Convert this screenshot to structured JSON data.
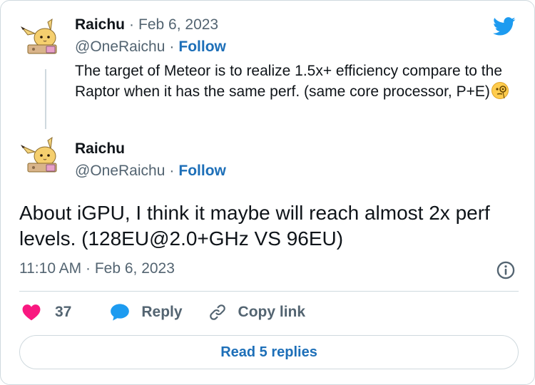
{
  "tweet1": {
    "author_name": "Raichu",
    "date": "Feb 6, 2023",
    "handle": "@OneRaichu",
    "follow_label": "Follow",
    "text": "The target of Meteor is to realize 1.5x+ efficiency compare to the Raptor when it has the same perf. (same core processor, P+E)",
    "emoji": "face-with-monocle"
  },
  "tweet2": {
    "author_name": "Raichu",
    "handle": "@OneRaichu",
    "follow_label": "Follow",
    "text": "About iGPU, I think it maybe will reach almost 2x perf levels. (128EU@2.0+GHz VS 96EU)",
    "timestamp": "11:10 AM · Feb 6, 2023"
  },
  "separator": "·",
  "actions": {
    "like_count": "37",
    "reply_label": "Reply",
    "copy_link_label": "Copy link"
  },
  "read_replies_label": "Read 5 replies",
  "icons": [
    "twitter-bird-icon",
    "heart-icon",
    "reply-bubble-icon",
    "link-icon",
    "info-icon"
  ],
  "colors": {
    "accent": "#1d9bf0",
    "link": "#1d6fb8",
    "heart": "#f91880",
    "muted": "#536471",
    "border": "#cfd9de"
  }
}
